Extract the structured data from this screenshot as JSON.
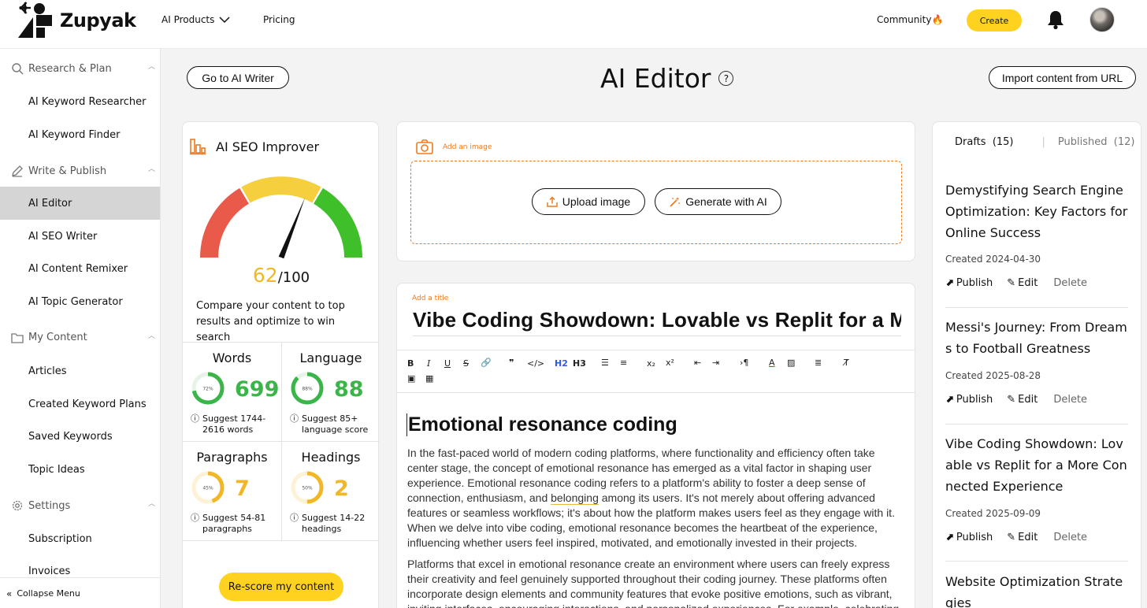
{
  "topbar": {
    "brand": "Zupyak",
    "nav": [
      {
        "label": "AI Products"
      },
      {
        "label": "Pricing"
      }
    ],
    "community": "Community🔥",
    "create": "Create"
  },
  "sidebar": {
    "sections": [
      {
        "label": "Research & Plan",
        "icon": "search-icon",
        "items": [
          "AI Keyword Researcher",
          "AI Keyword Finder"
        ]
      },
      {
        "label": "Write & Publish",
        "icon": "pen-icon",
        "items": [
          "AI Editor",
          "AI SEO Writer",
          "AI Content Remixer",
          "AI Topic Generator"
        ]
      },
      {
        "label": "My Content",
        "icon": "folder-icon",
        "items": [
          "Articles",
          "Created Keyword Plans",
          "Saved Keywords",
          "Topic Ideas"
        ]
      },
      {
        "label": "Settings",
        "icon": "gear-icon",
        "items": [
          "Subscription",
          "Invoices"
        ]
      }
    ],
    "active_item": "AI Editor",
    "collapse": "Collapse Menu"
  },
  "header": {
    "go_writer": "Go to AI Writer",
    "title": "AI Editor",
    "help": "?",
    "import": "Import content from URL"
  },
  "seo": {
    "title": "AI SEO Improver",
    "score": "62",
    "score_max": "/100",
    "score_value": 62,
    "description": "Compare your content to top results and optimize to win search",
    "metrics": [
      {
        "title": "Words",
        "value": "699",
        "ring_label": "72%",
        "ring_pct": 0.72,
        "color": "#3bb54a",
        "suggest": "Suggest 1744-2616 words"
      },
      {
        "title": "Language",
        "value": "88",
        "ring_label": "88%",
        "ring_pct": 0.88,
        "color": "#3bb54a",
        "suggest": "Suggest 85+ language score"
      },
      {
        "title": "Paragraphs",
        "value": "7",
        "ring_label": "45%",
        "ring_pct": 0.45,
        "color": "#f2b726",
        "suggest": "Suggest 54-81 paragraphs"
      },
      {
        "title": "Headings",
        "value": "2",
        "ring_label": "50%",
        "ring_pct": 0.5,
        "color": "#f2b726",
        "suggest": "Suggest 14-22 headings"
      }
    ],
    "rescore": "Re-score my content"
  },
  "image_panel": {
    "add": "Add an image",
    "upload": "Upload image",
    "generate": "Generate with AI"
  },
  "editor": {
    "add_title": "Add a title",
    "title": "Vibe Coding Showdown: Lovable vs Replit for a Mor",
    "toolbar": {
      "h2": "H2",
      "h3": "H3"
    },
    "heading": "Emotional resonance coding",
    "p1_a": "In the fast-paced world of modern coding platforms, where functionality and efficiency often take center stage, the concept of emotional resonance has emerged as a vital factor in shaping user experience. Emotional resonance coding refers to a platform's ability to foster a deep sense of connection, enthusiasm, and ",
    "p1_u": "belonging",
    "p1_b": " among its users. It's not merely about offering advanced features or seamless workflows; it's about how the platform makes users feel as they engage with it. When we delve into vibe coding, emotional resonance becomes the heartbeat of the experience, influencing whether users feel inspired, motivated, and emotionally invested in their projects.",
    "p2": "Platforms that excel in emotional resonance create an environment where users can freely express their creativity and feel genuinely supported throughout their coding journey. These platforms often incorporate design elements and community features that evoke positive emotions, such as vibrant, inviting interfaces, encouraging interactions, and personalized experiences. For example, celebrating user milestones or"
  },
  "drafts": {
    "tab_drafts": "Drafts",
    "drafts_count": "(15)",
    "tab_published": "Published",
    "published_count": "(12)",
    "publish": "Publish",
    "edit": "Edit",
    "delete": "Delete",
    "items": [
      {
        "title": "Demystifying Search Engine Optimization: Key Factors for Online Success",
        "created": "Created 2024-04-30"
      },
      {
        "title": "Messi's Journey: From Dreams to Football Greatness",
        "created": "Created 2025-08-28"
      },
      {
        "title": "Vibe Coding Showdown: Lovable vs Replit for a More Connected Experience",
        "created": "Created 2025-09-09"
      },
      {
        "title": "Website Optimization Strategies",
        "created": ""
      }
    ]
  }
}
